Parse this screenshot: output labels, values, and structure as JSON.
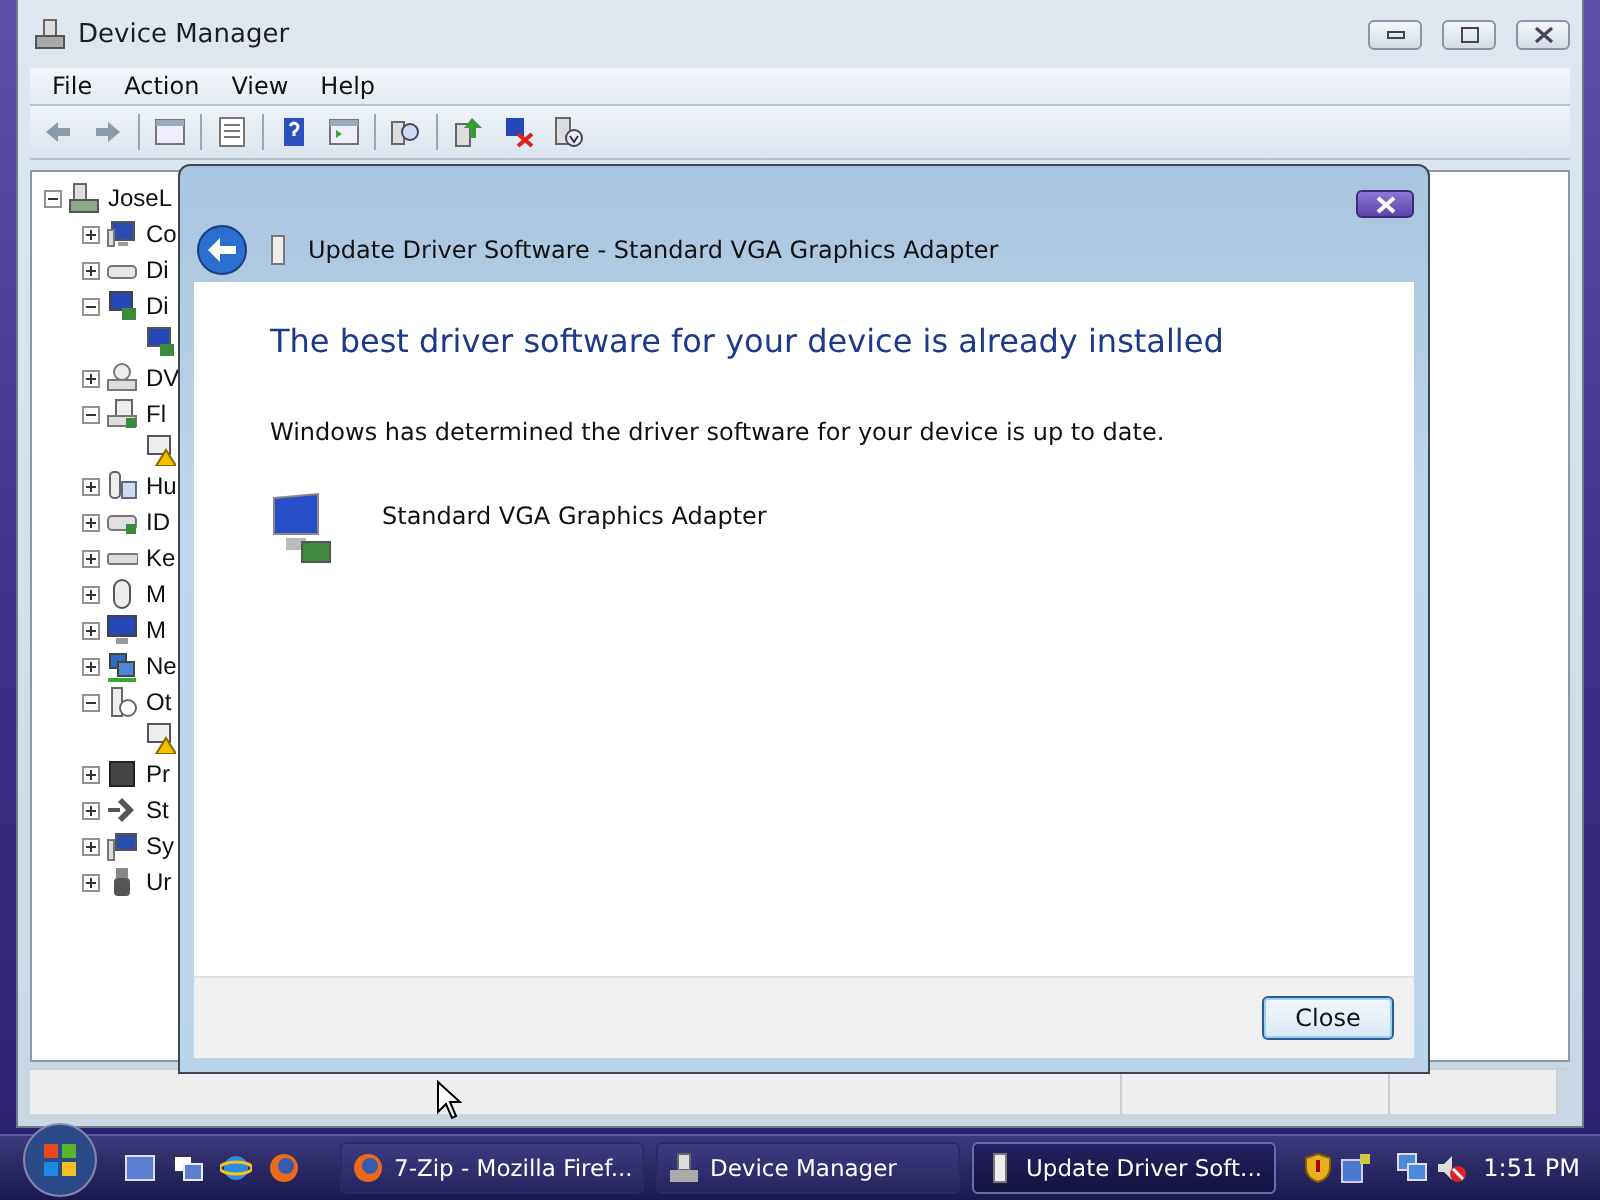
{
  "device_manager": {
    "title": "Device Manager",
    "menu": [
      "File",
      "Action",
      "View",
      "Help"
    ],
    "tree": [
      {
        "label": "JoseL",
        "expanded": true,
        "children": [
          {
            "label": "Co",
            "expanded": false
          },
          {
            "label": "Di",
            "expanded": false
          },
          {
            "label": "Di",
            "expanded": true,
            "children": [
              {
                "warning": false
              }
            ]
          },
          {
            "label": "DV",
            "expanded": false
          },
          {
            "label": "Fl",
            "expanded": true,
            "children": [
              {
                "warning": true
              }
            ]
          },
          {
            "label": "Hu",
            "expanded": false
          },
          {
            "label": "ID",
            "expanded": false
          },
          {
            "label": "Ke",
            "expanded": false
          },
          {
            "label": "M",
            "expanded": false
          },
          {
            "label": "M",
            "expanded": false
          },
          {
            "label": "Ne",
            "expanded": false
          },
          {
            "label": "Ot",
            "expanded": true,
            "children": [
              {
                "warning": true
              }
            ]
          },
          {
            "label": "Pr",
            "expanded": false
          },
          {
            "label": "St",
            "expanded": false
          },
          {
            "label": "Sy",
            "expanded": false
          },
          {
            "label": "Ur",
            "expanded": false
          }
        ]
      }
    ]
  },
  "dialog": {
    "title": "Update Driver Software - Standard VGA Graphics Adapter",
    "heading": "The best driver software for your device is already installed",
    "message": "Windows has determined the driver software for your device is up to date.",
    "device_name": "Standard VGA Graphics Adapter",
    "buttons": [
      "Close"
    ]
  },
  "taskbar": {
    "tasks": [
      {
        "label": "7-Zip - Mozilla Firef...",
        "selected": false
      },
      {
        "label": "Device Manager",
        "selected": false
      },
      {
        "label": "Update Driver Soft...",
        "selected": true
      }
    ],
    "clock": "1:51 PM"
  }
}
